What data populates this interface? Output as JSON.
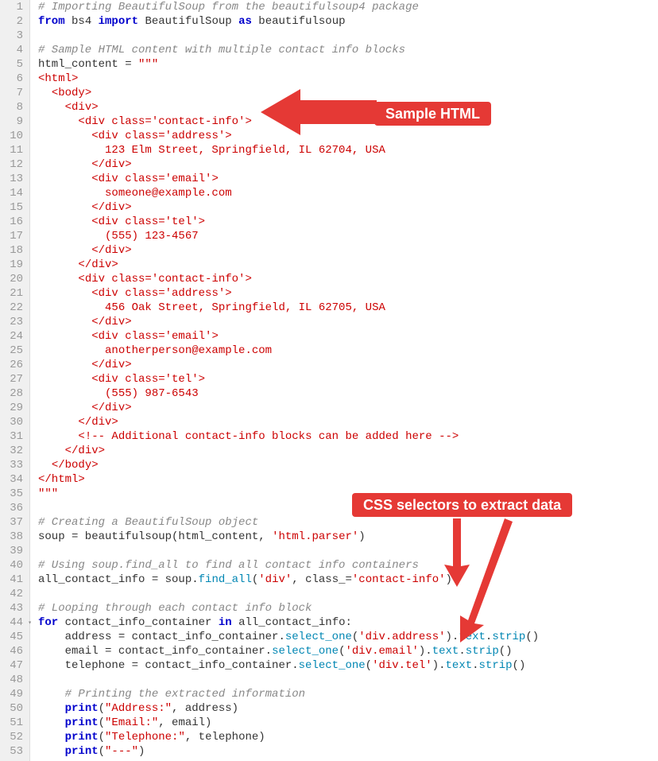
{
  "callouts": {
    "sample_html": "Sample HTML",
    "css_selectors": "CSS selectors to extract data"
  },
  "lines": [
    {
      "n": "1",
      "segs": [
        {
          "t": "# Importing BeautifulSoup from the beautifulsoup4 package",
          "c": "c-comment"
        }
      ]
    },
    {
      "n": "2",
      "segs": [
        {
          "t": "from",
          "c": "c-kw"
        },
        {
          "t": " bs4 "
        },
        {
          "t": "import",
          "c": "c-kw"
        },
        {
          "t": " BeautifulSoup "
        },
        {
          "t": "as",
          "c": "c-kw"
        },
        {
          "t": " beautifulsoup"
        }
      ]
    },
    {
      "n": "3",
      "segs": []
    },
    {
      "n": "4",
      "segs": [
        {
          "t": "# Sample HTML content with multiple contact info blocks",
          "c": "c-comment"
        }
      ]
    },
    {
      "n": "5",
      "segs": [
        {
          "t": "html_content = "
        },
        {
          "t": "\"\"\"",
          "c": "c-str"
        }
      ]
    },
    {
      "n": "6",
      "segs": [
        {
          "t": "<html>",
          "c": "c-tag"
        }
      ]
    },
    {
      "n": "7",
      "segs": [
        {
          "t": "  "
        },
        {
          "t": "<body>",
          "c": "c-tag"
        }
      ]
    },
    {
      "n": "8",
      "segs": [
        {
          "t": "    "
        },
        {
          "t": "<div>",
          "c": "c-tag"
        }
      ]
    },
    {
      "n": "9",
      "segs": [
        {
          "t": "      "
        },
        {
          "t": "<div class='contact-info'>",
          "c": "c-tag"
        }
      ]
    },
    {
      "n": "10",
      "segs": [
        {
          "t": "        "
        },
        {
          "t": "<div class='address'>",
          "c": "c-tag"
        }
      ]
    },
    {
      "n": "11",
      "segs": [
        {
          "t": "          123 Elm Street, Springfield, IL 62704, USA",
          "c": "c-tag"
        }
      ]
    },
    {
      "n": "12",
      "segs": [
        {
          "t": "        "
        },
        {
          "t": "</div>",
          "c": "c-tag"
        }
      ]
    },
    {
      "n": "13",
      "segs": [
        {
          "t": "        "
        },
        {
          "t": "<div class='email'>",
          "c": "c-tag"
        }
      ]
    },
    {
      "n": "14",
      "segs": [
        {
          "t": "          someone@example.com",
          "c": "c-tag"
        }
      ]
    },
    {
      "n": "15",
      "segs": [
        {
          "t": "        "
        },
        {
          "t": "</div>",
          "c": "c-tag"
        }
      ]
    },
    {
      "n": "16",
      "segs": [
        {
          "t": "        "
        },
        {
          "t": "<div class='tel'>",
          "c": "c-tag"
        }
      ]
    },
    {
      "n": "17",
      "segs": [
        {
          "t": "          (555) 123-4567",
          "c": "c-tag"
        }
      ]
    },
    {
      "n": "18",
      "segs": [
        {
          "t": "        "
        },
        {
          "t": "</div>",
          "c": "c-tag"
        }
      ]
    },
    {
      "n": "19",
      "segs": [
        {
          "t": "      "
        },
        {
          "t": "</div>",
          "c": "c-tag"
        }
      ]
    },
    {
      "n": "20",
      "segs": [
        {
          "t": "      "
        },
        {
          "t": "<div class='contact-info'>",
          "c": "c-tag"
        }
      ]
    },
    {
      "n": "21",
      "segs": [
        {
          "t": "        "
        },
        {
          "t": "<div class='address'>",
          "c": "c-tag"
        }
      ]
    },
    {
      "n": "22",
      "segs": [
        {
          "t": "          456 Oak Street, Springfield, IL 62705, USA",
          "c": "c-tag"
        }
      ]
    },
    {
      "n": "23",
      "segs": [
        {
          "t": "        "
        },
        {
          "t": "</div>",
          "c": "c-tag"
        }
      ]
    },
    {
      "n": "24",
      "segs": [
        {
          "t": "        "
        },
        {
          "t": "<div class='email'>",
          "c": "c-tag"
        }
      ]
    },
    {
      "n": "25",
      "segs": [
        {
          "t": "          anotherperson@example.com",
          "c": "c-tag"
        }
      ]
    },
    {
      "n": "26",
      "segs": [
        {
          "t": "        "
        },
        {
          "t": "</div>",
          "c": "c-tag"
        }
      ]
    },
    {
      "n": "27",
      "segs": [
        {
          "t": "        "
        },
        {
          "t": "<div class='tel'>",
          "c": "c-tag"
        }
      ]
    },
    {
      "n": "28",
      "segs": [
        {
          "t": "          (555) 987-6543",
          "c": "c-tag"
        }
      ]
    },
    {
      "n": "29",
      "segs": [
        {
          "t": "        "
        },
        {
          "t": "</div>",
          "c": "c-tag"
        }
      ]
    },
    {
      "n": "30",
      "segs": [
        {
          "t": "      "
        },
        {
          "t": "</div>",
          "c": "c-tag"
        }
      ]
    },
    {
      "n": "31",
      "segs": [
        {
          "t": "      "
        },
        {
          "t": "<!-- Additional contact-info blocks can be added here -->",
          "c": "c-tag"
        }
      ]
    },
    {
      "n": "32",
      "segs": [
        {
          "t": "    "
        },
        {
          "t": "</div>",
          "c": "c-tag"
        }
      ]
    },
    {
      "n": "33",
      "segs": [
        {
          "t": "  "
        },
        {
          "t": "</body>",
          "c": "c-tag"
        }
      ]
    },
    {
      "n": "34",
      "segs": [
        {
          "t": "</html>",
          "c": "c-tag"
        }
      ]
    },
    {
      "n": "35",
      "segs": [
        {
          "t": "\"\"\"",
          "c": "c-str"
        }
      ]
    },
    {
      "n": "36",
      "segs": []
    },
    {
      "n": "37",
      "segs": [
        {
          "t": "# Creating a BeautifulSoup object",
          "c": "c-comment"
        }
      ]
    },
    {
      "n": "38",
      "segs": [
        {
          "t": "soup = beautifulsoup(html_content, "
        },
        {
          "t": "'html.parser'",
          "c": "c-str"
        },
        {
          "t": ")"
        }
      ]
    },
    {
      "n": "39",
      "segs": []
    },
    {
      "n": "40",
      "segs": [
        {
          "t": "# Using soup.find_all to find all contact info containers",
          "c": "c-comment"
        }
      ]
    },
    {
      "n": "41",
      "segs": [
        {
          "t": "all_contact_info = soup."
        },
        {
          "t": "find_all",
          "c": "c-method"
        },
        {
          "t": "("
        },
        {
          "t": "'div'",
          "c": "c-str"
        },
        {
          "t": ", class_="
        },
        {
          "t": "'contact-info'",
          "c": "c-str"
        },
        {
          "t": ")"
        }
      ]
    },
    {
      "n": "42",
      "segs": []
    },
    {
      "n": "43",
      "segs": [
        {
          "t": "# Looping through each contact info block",
          "c": "c-comment"
        }
      ]
    },
    {
      "n": "44",
      "fold": true,
      "segs": [
        {
          "t": "for",
          "c": "c-kw"
        },
        {
          "t": " contact_info_container "
        },
        {
          "t": "in",
          "c": "c-kw"
        },
        {
          "t": " all_contact_info:"
        }
      ]
    },
    {
      "n": "45",
      "segs": [
        {
          "t": "    address = contact_info_container."
        },
        {
          "t": "select_one",
          "c": "c-method"
        },
        {
          "t": "("
        },
        {
          "t": "'div.address'",
          "c": "c-str"
        },
        {
          "t": ")."
        },
        {
          "t": "text",
          "c": "c-method"
        },
        {
          "t": "."
        },
        {
          "t": "strip",
          "c": "c-method"
        },
        {
          "t": "()"
        }
      ]
    },
    {
      "n": "46",
      "segs": [
        {
          "t": "    email = contact_info_container."
        },
        {
          "t": "select_one",
          "c": "c-method"
        },
        {
          "t": "("
        },
        {
          "t": "'div.email'",
          "c": "c-str"
        },
        {
          "t": ")."
        },
        {
          "t": "text",
          "c": "c-method"
        },
        {
          "t": "."
        },
        {
          "t": "strip",
          "c": "c-method"
        },
        {
          "t": "()"
        }
      ]
    },
    {
      "n": "47",
      "segs": [
        {
          "t": "    telephone = contact_info_container."
        },
        {
          "t": "select_one",
          "c": "c-method"
        },
        {
          "t": "("
        },
        {
          "t": "'div.tel'",
          "c": "c-str"
        },
        {
          "t": ")."
        },
        {
          "t": "text",
          "c": "c-method"
        },
        {
          "t": "."
        },
        {
          "t": "strip",
          "c": "c-method"
        },
        {
          "t": "()"
        }
      ]
    },
    {
      "n": "48",
      "segs": []
    },
    {
      "n": "49",
      "segs": [
        {
          "t": "    "
        },
        {
          "t": "# Printing the extracted information",
          "c": "c-comment"
        }
      ]
    },
    {
      "n": "50",
      "segs": [
        {
          "t": "    "
        },
        {
          "t": "print",
          "c": "c-kw"
        },
        {
          "t": "("
        },
        {
          "t": "\"Address:\"",
          "c": "c-str"
        },
        {
          "t": ", address)"
        }
      ]
    },
    {
      "n": "51",
      "segs": [
        {
          "t": "    "
        },
        {
          "t": "print",
          "c": "c-kw"
        },
        {
          "t": "("
        },
        {
          "t": "\"Email:\"",
          "c": "c-str"
        },
        {
          "t": ", email)"
        }
      ]
    },
    {
      "n": "52",
      "segs": [
        {
          "t": "    "
        },
        {
          "t": "print",
          "c": "c-kw"
        },
        {
          "t": "("
        },
        {
          "t": "\"Telephone:\"",
          "c": "c-str"
        },
        {
          "t": ", telephone)"
        }
      ]
    },
    {
      "n": "53",
      "segs": [
        {
          "t": "    "
        },
        {
          "t": "print",
          "c": "c-kw"
        },
        {
          "t": "("
        },
        {
          "t": "\"---\"",
          "c": "c-str"
        },
        {
          "t": ")"
        }
      ]
    }
  ]
}
